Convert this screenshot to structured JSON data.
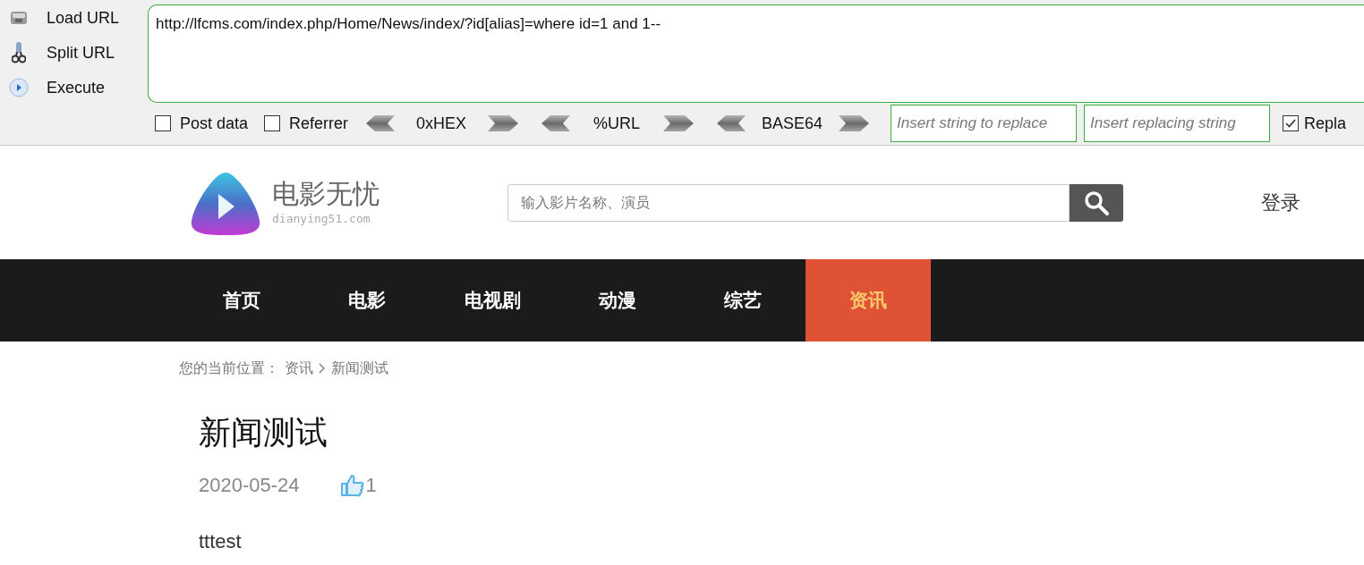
{
  "toolbar": {
    "actions": [
      {
        "kind": "load",
        "label": "Load URL"
      },
      {
        "kind": "split",
        "label": "Split URL"
      },
      {
        "kind": "execute",
        "label": "Execute"
      }
    ],
    "url": "http://lfcms.com/index.php/Home/News/index/?id[alias]=where id=1 and 1--",
    "options": [
      {
        "label": "Post data",
        "checked": false
      },
      {
        "label": "Referrer",
        "checked": false
      }
    ],
    "encoders": [
      "0xHEX",
      "%URL",
      "BASE64"
    ],
    "replace_from": {
      "placeholder": "Insert string to replace"
    },
    "replace_to": {
      "placeholder": "Insert replacing string"
    },
    "replace_all": {
      "label": "Repla",
      "checked": true
    }
  },
  "site": {
    "logo_title": "电影无忧",
    "logo_domain": "dianying51.com",
    "search": {
      "placeholder": "输入影片名称、演员"
    },
    "login": "登录",
    "nav": [
      {
        "label": "首页",
        "selected": false
      },
      {
        "label": "电影",
        "selected": false
      },
      {
        "label": "电视剧",
        "selected": false
      },
      {
        "label": "动漫",
        "selected": false
      },
      {
        "label": "综艺",
        "selected": false
      },
      {
        "label": "资讯",
        "selected": true
      }
    ],
    "breadcrumb": {
      "prefix": "您的当前位置：",
      "items": [
        "资讯",
        "新闻测试"
      ]
    }
  },
  "article": {
    "title": "新闻测试",
    "date": "2020-05-24",
    "likes": "1",
    "body": "tttest"
  }
}
